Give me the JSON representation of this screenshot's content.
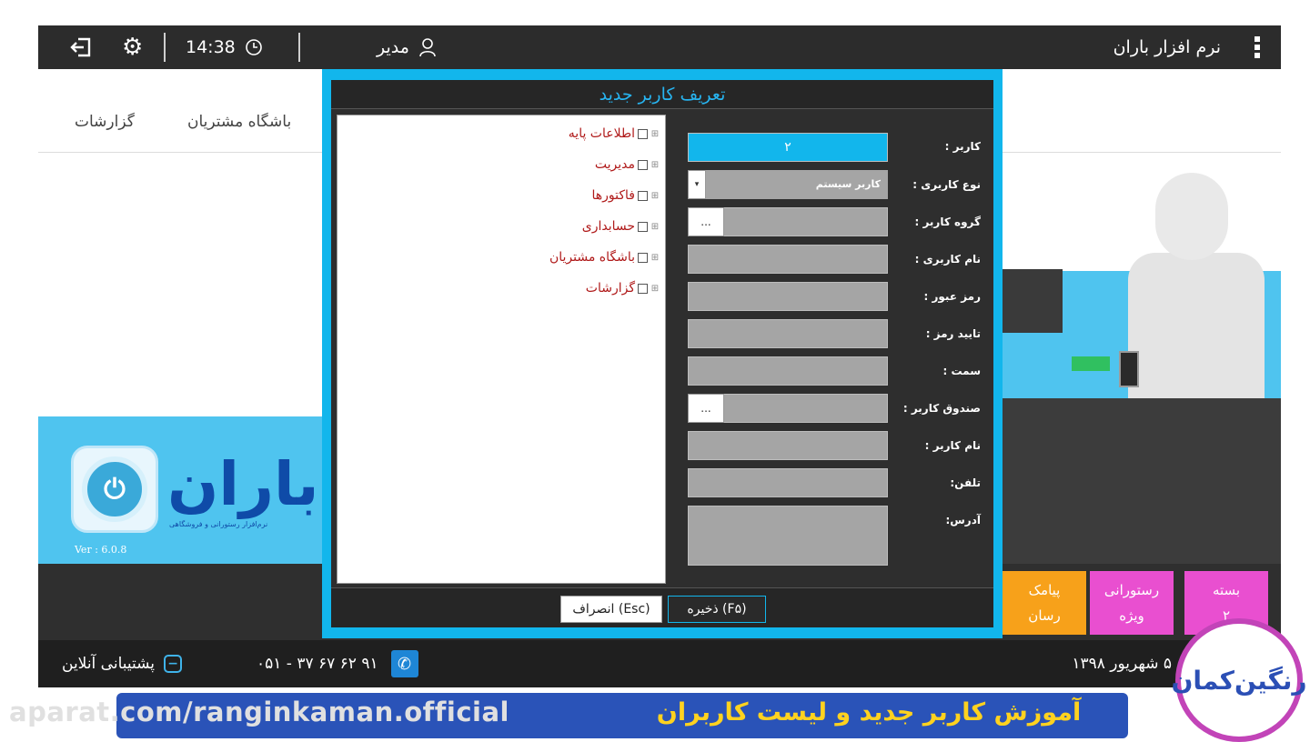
{
  "app": {
    "title": "نرم افزار باران"
  },
  "topbar": {
    "time": "14:38",
    "user": "مدیر",
    "icons": {
      "menu": "kebab-menu-icon",
      "user": "user-icon",
      "clock": "clock-icon",
      "settings": "gear-icon",
      "logout": "logout-icon"
    }
  },
  "menu": {
    "items": [
      "باشگاه مشتریان",
      "گزارشات"
    ]
  },
  "brand": {
    "logo_text": "باران",
    "tagline": "نرم‌افزار رستورانی و فروشگاهی",
    "version": "Ver : 6.0.8"
  },
  "tiles": [
    {
      "label_1": "بسته",
      "label_2": "۲",
      "color": "#e94fd0"
    },
    {
      "label_1": "رستورانی",
      "label_2": "ویژه",
      "color": "#e94fd0"
    },
    {
      "label_1": "پیامک",
      "label_2": "رسان",
      "color": "#f7a11a"
    }
  ],
  "status": {
    "date": "۵ شهریور ۱۳۹۸",
    "phone": "۰۵۱ - ۳۷ ۶۷ ۶۲ ۹۱",
    "support": "پشتیبانی آنلاین"
  },
  "dialog": {
    "title": "تعریف کاربر جدید",
    "tree": [
      "اطلاعات پایه",
      "مدیریت",
      "فاکتورها",
      "حسابداری",
      "باشگاه مشتریان",
      "گزارشات"
    ],
    "fields": {
      "user_code_label": "کاربر :",
      "user_code_value": "۲",
      "user_type_label": "نوع کاربری :",
      "user_type_value": "کاربر سیستم",
      "user_group_label": "گروه کاربر :",
      "username_label": "نام کاربری :",
      "password_label": "رمز عبور :",
      "confirm_label": "تایید رمز :",
      "position_label": "سمت :",
      "cashbox_label": "صندوق کاربر :",
      "fullname_label": "نام کاربر :",
      "phone_label": "تلفن:",
      "address_label": "آدرس:",
      "dots": "..."
    },
    "buttons": {
      "save": "ذخیره (F۵)",
      "cancel": "انصراف (Esc)"
    }
  },
  "watermark": {
    "url": "aparat.com/ranginkaman.official",
    "title": "آموزش کاربر جدید و لیست کاربران",
    "logo_text": "رنگین‌کمان"
  }
}
